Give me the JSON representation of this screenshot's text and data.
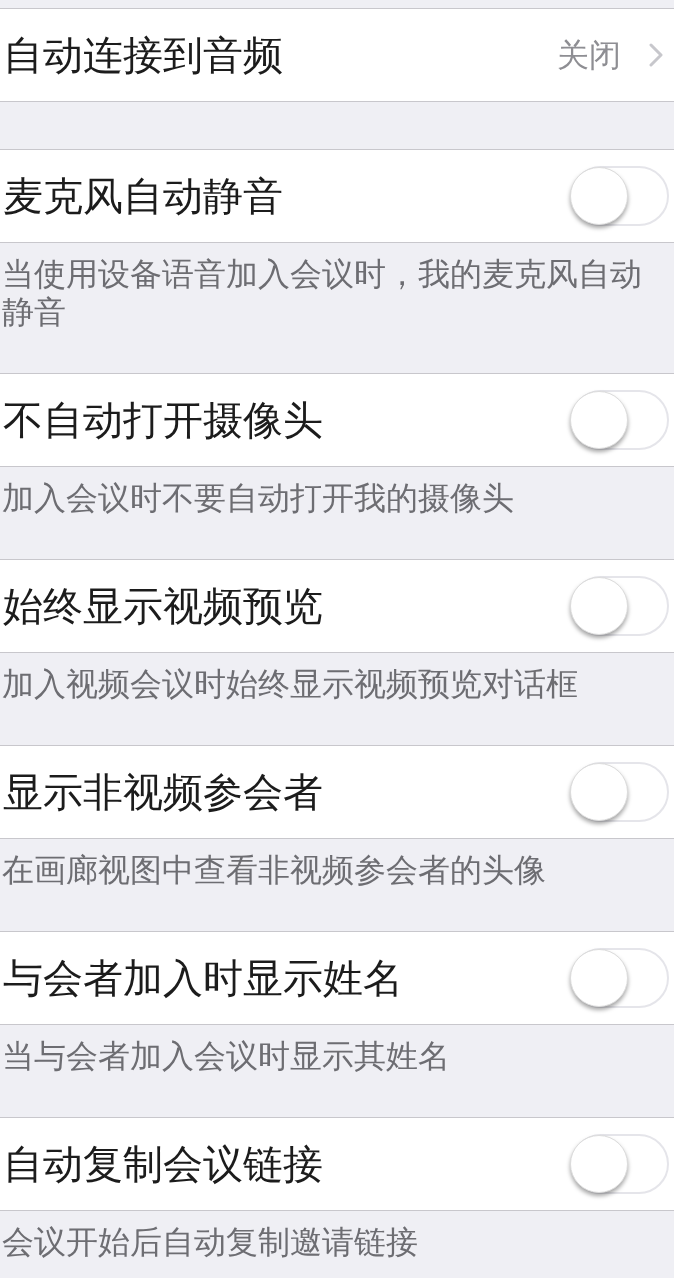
{
  "settings": [
    {
      "kind": "value",
      "label": "自动连接到音频",
      "value": "关闭"
    },
    {
      "kind": "toggle",
      "label": "麦克风自动静音",
      "on": false,
      "description": "当使用设备语音加入会议时，我的麦克风自动静音"
    },
    {
      "kind": "toggle",
      "label": "不自动打开摄像头",
      "on": false,
      "description": "加入会议时不要自动打开我的摄像头"
    },
    {
      "kind": "toggle",
      "label": "始终显示视频预览",
      "on": false,
      "description": "加入视频会议时始终显示视频预览对话框"
    },
    {
      "kind": "toggle",
      "label": "显示非视频参会者",
      "on": false,
      "description": "在画廊视图中查看非视频参会者的头像"
    },
    {
      "kind": "toggle",
      "label": "与会者加入时显示姓名",
      "on": false,
      "description": "当与会者加入会议时显示其姓名"
    },
    {
      "kind": "toggle",
      "label": "自动复制会议链接",
      "on": false,
      "description": "会议开始后自动复制邀请链接"
    }
  ]
}
